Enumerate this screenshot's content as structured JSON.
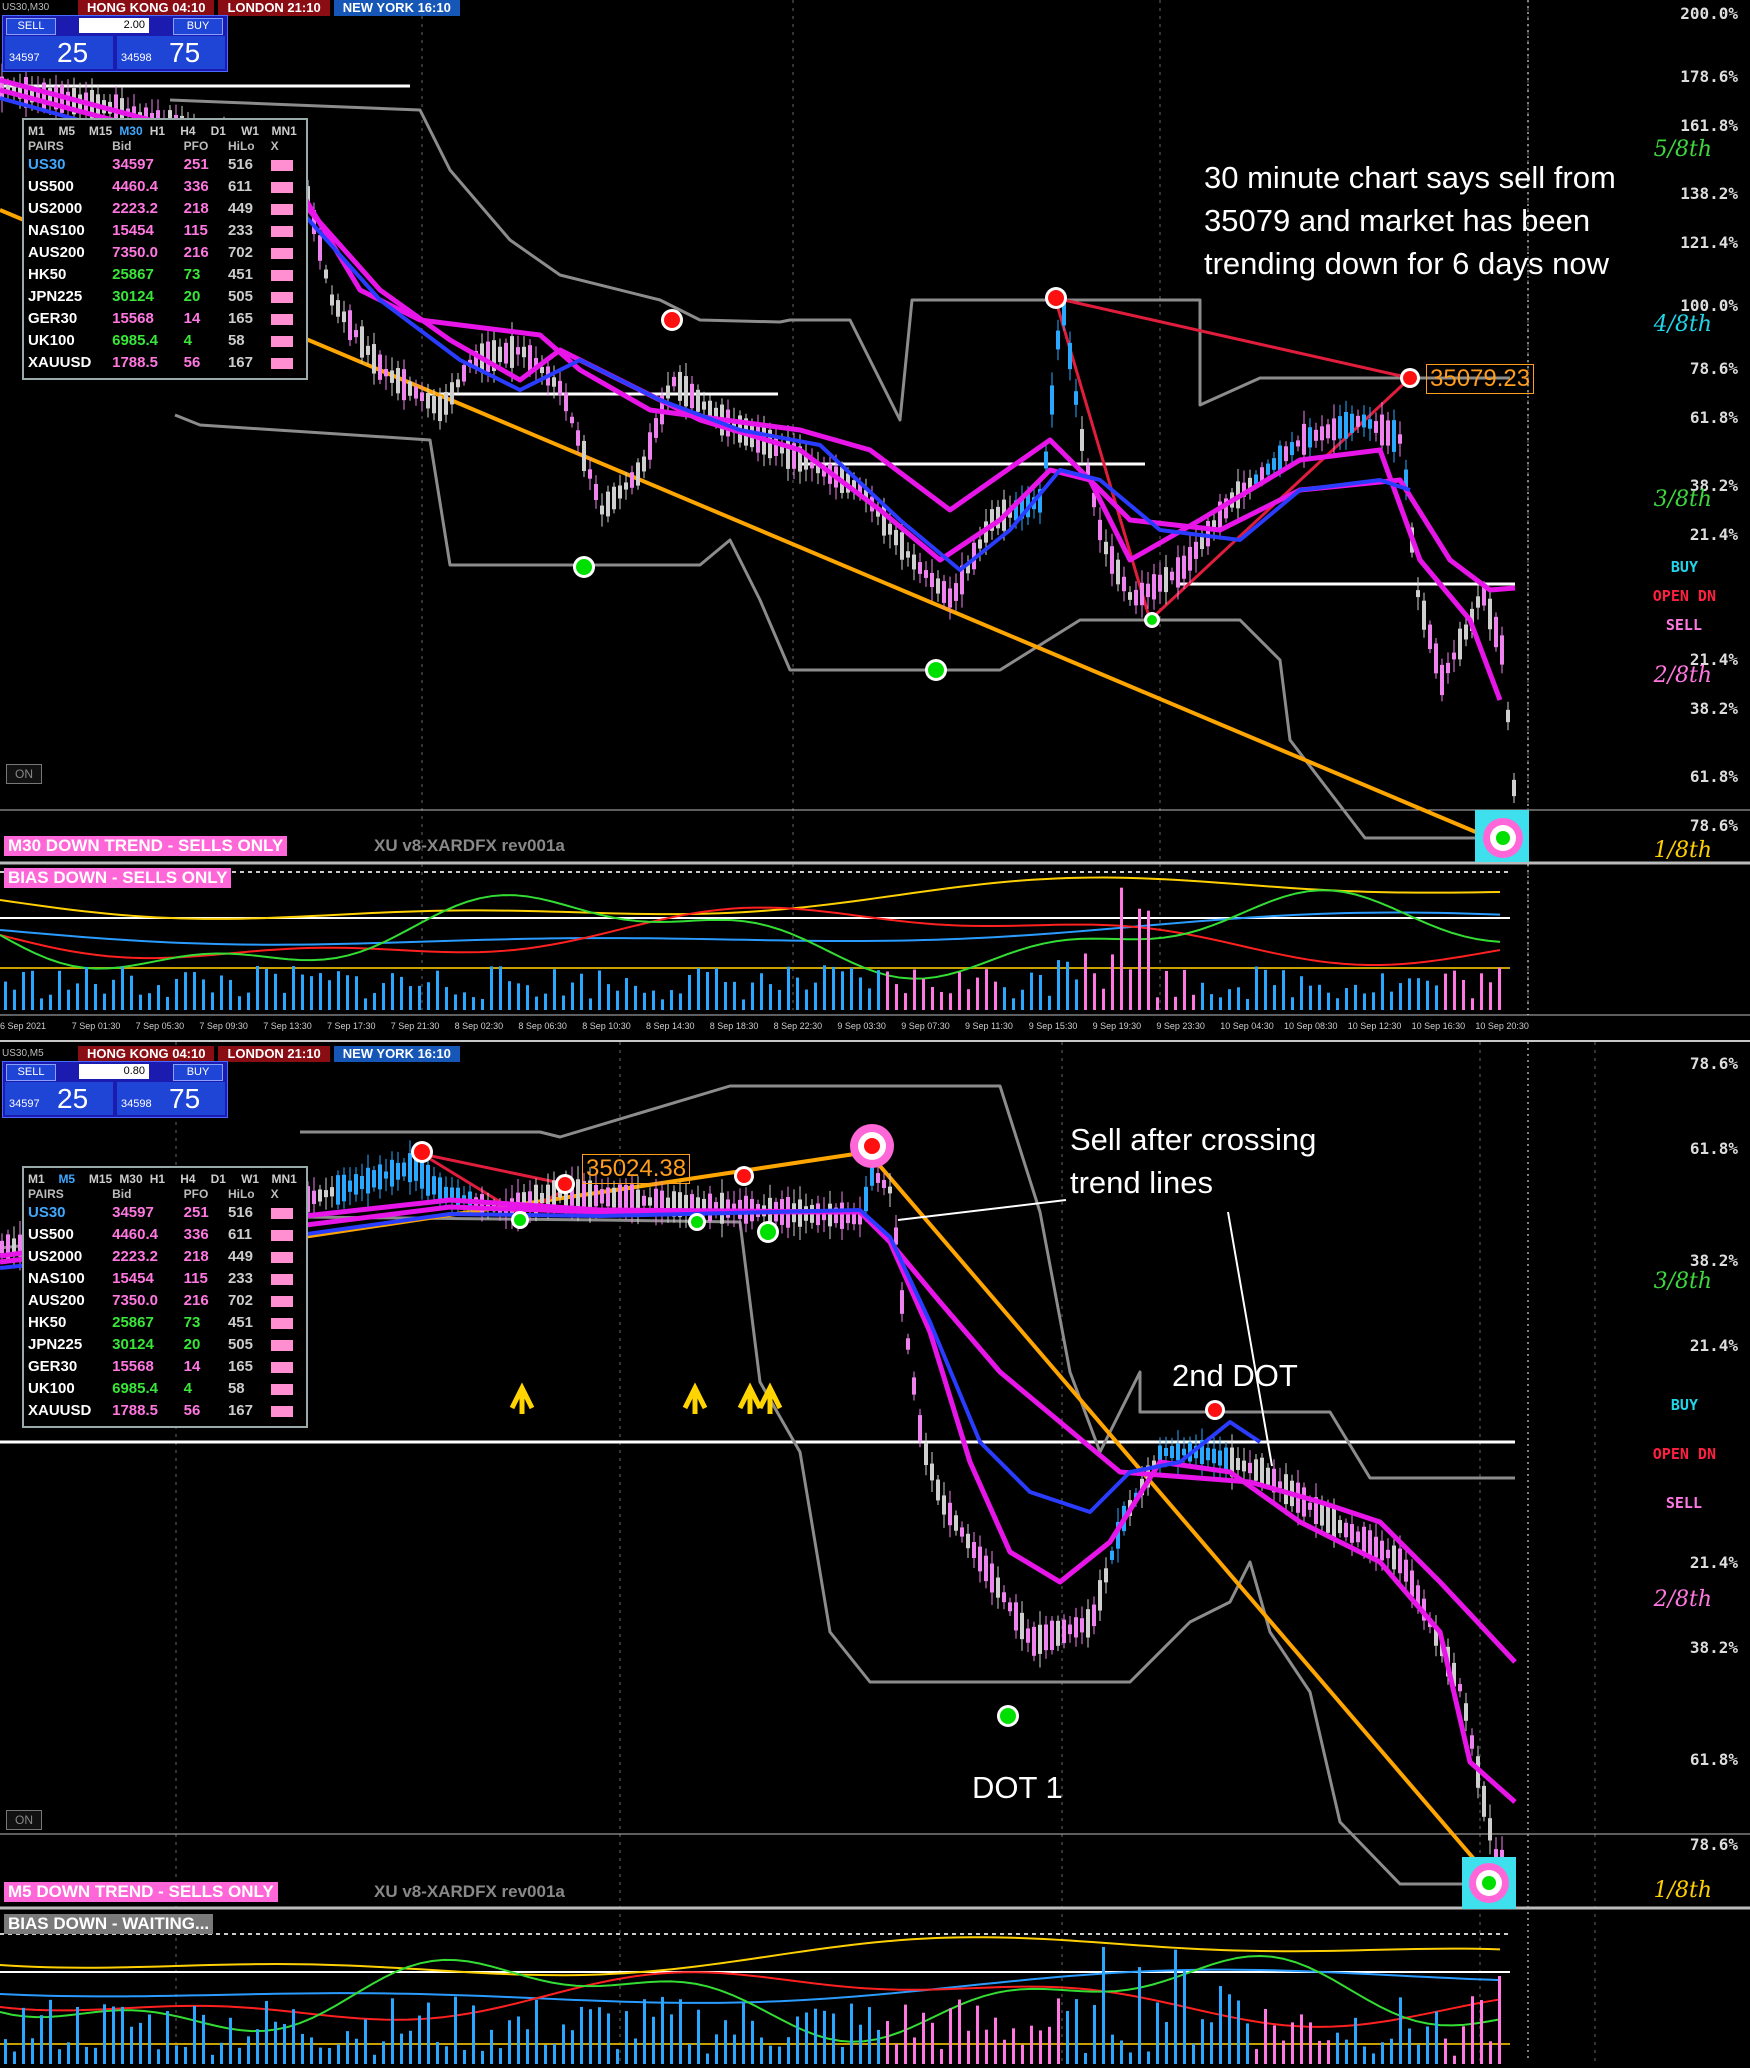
{
  "top": {
    "symbol": "US30,M30",
    "sessions": {
      "hk": "HONG KONG 04:10",
      "london": "LONDON  21:10",
      "ny": "NEW YORK  16:10"
    },
    "trade": {
      "sell_label": "SELL",
      "buy_label": "BUY",
      "lot": "2.00",
      "sell_small": "34597",
      "sell_big": "25",
      "buy_small": "34598",
      "buy_big": "75"
    },
    "pairs_panel": {
      "timeframes": [
        "M1",
        "M5",
        "M15",
        "M30",
        "H1",
        "H4",
        "D1",
        "W1",
        "MN1"
      ],
      "active_tf": "M30",
      "headers": [
        "PAIRS",
        "Bid",
        "PFO",
        "HiLo",
        "X"
      ],
      "rows": [
        {
          "name": "US30",
          "bid": "34597",
          "pfo": "251",
          "hilo": "516",
          "name_color": "#3fa8ff",
          "bid_color": "#ff77e0"
        },
        {
          "name": "US500",
          "bid": "4460.4",
          "pfo": "336",
          "hilo": "611",
          "name_color": "#ffffff",
          "bid_color": "#ff77e0"
        },
        {
          "name": "US2000",
          "bid": "2223.2",
          "pfo": "218",
          "hilo": "449",
          "name_color": "#ffffff",
          "bid_color": "#ff77e0"
        },
        {
          "name": "NAS100",
          "bid": "15454",
          "pfo": "115",
          "hilo": "233",
          "name_color": "#ffffff",
          "bid_color": "#ff77e0"
        },
        {
          "name": "AUS200",
          "bid": "7350.0",
          "pfo": "216",
          "hilo": "702",
          "name_color": "#ffffff",
          "bid_color": "#ff77e0"
        },
        {
          "name": "HK50",
          "bid": "25867",
          "pfo": "73",
          "hilo": "451",
          "name_color": "#ffffff",
          "bid_color": "#39e639"
        },
        {
          "name": "JPN225",
          "bid": "30124",
          "pfo": "20",
          "hilo": "505",
          "name_color": "#ffffff",
          "bid_color": "#39e639"
        },
        {
          "name": "GER30",
          "bid": "15568",
          "pfo": "14",
          "hilo": "165",
          "name_color": "#ffffff",
          "bid_color": "#ff77e0"
        },
        {
          "name": "UK100",
          "bid": "6985.4",
          "pfo": "4",
          "hilo": "58",
          "name_color": "#ffffff",
          "bid_color": "#39e639"
        },
        {
          "name": "XAUUSD",
          "bid": "1788.5",
          "pfo": "56",
          "hilo": "167",
          "name_color": "#ffffff",
          "bid_color": "#ff77e0"
        }
      ]
    },
    "y_labels": [
      "200.0%",
      "178.6%",
      "161.8%",
      "138.2%",
      "121.4%",
      "100.0%",
      "78.6%",
      "61.8%",
      "38.2%",
      "21.4%",
      "21.4%",
      "38.2%",
      "61.8%",
      "78.6%"
    ],
    "octaves": {
      "o58": "5/8th",
      "o48": "4/8th",
      "o38": "3/8th",
      "o28": "2/8th",
      "o18": "1/8th"
    },
    "signals": {
      "buy": "BUY",
      "open": "OPEN DN",
      "sell": "SELL"
    },
    "annotation": "30 minute chart says sell from 35079 and market has been trending down for 6 days now",
    "price_label": "35079.23",
    "banner": "M30  DOWN TREND - SELLS ONLY",
    "version": "XU v8-XARDFX rev001a",
    "bias": "BIAS DOWN - SELLS ONLY",
    "on_label": "ON",
    "time_labels": [
      "6 Sep 2021",
      "7 Sep 01:30",
      "7 Sep 05:30",
      "7 Sep 09:30",
      "7 Sep 13:30",
      "7 Sep 17:30",
      "7 Sep 21:30",
      "8 Sep 02:30",
      "8 Sep 06:30",
      "8 Sep 10:30",
      "8 Sep 14:30",
      "8 Sep 18:30",
      "8 Sep 22:30",
      "9 Sep 03:30",
      "9 Sep 07:30",
      "9 Sep 11:30",
      "9 Sep 15:30",
      "9 Sep 19:30",
      "9 Sep 23:30",
      "10 Sep 04:30",
      "10 Sep 08:30",
      "10 Sep 12:30",
      "10 Sep 16:30",
      "10 Sep 20:30"
    ]
  },
  "bottom": {
    "symbol": "US30,M5",
    "sessions": {
      "hk": "HONG KONG 04:10",
      "london": "LONDON  21:10",
      "ny": "NEW YORK  16:10"
    },
    "trade": {
      "sell_label": "SELL",
      "buy_label": "BUY",
      "lot": "0.80",
      "sell_small": "34597",
      "sell_big": "25",
      "buy_small": "34598",
      "buy_big": "75"
    },
    "active_tf": "M5",
    "y_labels": [
      "78.6%",
      "61.8%",
      "38.2%",
      "21.4%",
      "21.4%",
      "38.2%",
      "61.8%",
      "78.6%"
    ],
    "octaves": {
      "o38": "3/8th",
      "o28": "2/8th",
      "o18": "1/8th"
    },
    "signals": {
      "buy": "BUY",
      "open": "OPEN DN",
      "sell": "SELL"
    },
    "annotation_sell": "Sell after crossing trend lines",
    "annotation_dot2": "2nd DOT",
    "annotation_dot1": "DOT 1",
    "price_label": "35024.38",
    "banner": "M5  DOWN TREND - SELLS ONLY",
    "version": "XU v8-XARDFX rev001a",
    "bias": "BIAS DOWN - WAITING...",
    "on_label": "ON"
  },
  "colors": {
    "ema_magenta": "#e815e8",
    "ema_blue": "#2a3cff",
    "channel": "#8c8c8c",
    "trend_orange": "#ffa500",
    "trend_red": "#e01d3c",
    "bull": "#2aa8ff",
    "bear": "#ee82ee",
    "neutral": "#cfcfcf",
    "dot_green": "#00e000",
    "dot_red": "#ff1010"
  }
}
